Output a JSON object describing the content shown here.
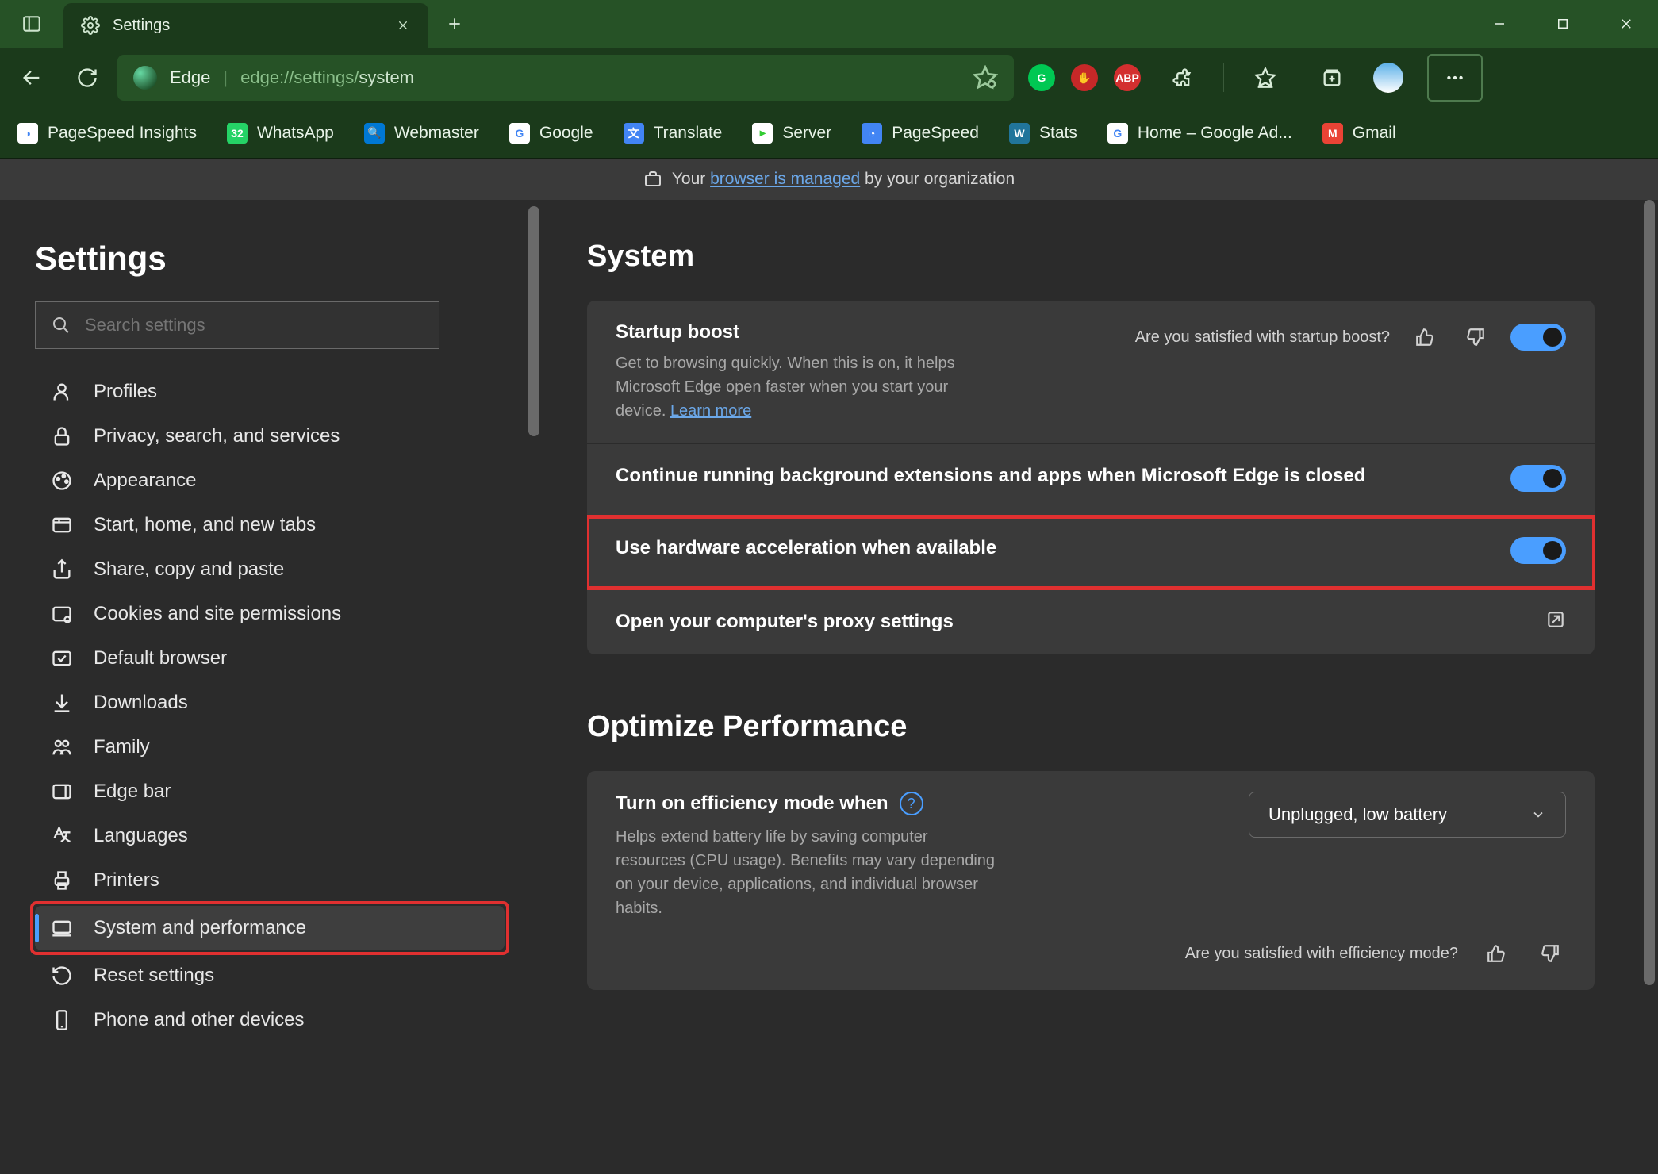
{
  "titlebar": {
    "tab_title": "Settings"
  },
  "toolbar": {
    "app_label": "Edge",
    "url_prefix": "edge://settings/",
    "url_path": "system"
  },
  "bookmarks": [
    {
      "label": "PageSpeed Insights",
      "color": "#fff",
      "bg": "linear-gradient(135deg,#4285f4,#ea4335,#fbbc05,#34a853)"
    },
    {
      "label": "WhatsApp",
      "color": "#fff",
      "bg": "#25d366",
      "badge": "32"
    },
    {
      "label": "Webmaster",
      "color": "#fff",
      "bg": "#0078d4"
    },
    {
      "label": "Google",
      "color": "",
      "bg": ""
    },
    {
      "label": "Translate",
      "color": "#fff",
      "bg": "#4285f4"
    },
    {
      "label": "Server",
      "color": "#3c3",
      "bg": "#fff"
    },
    {
      "label": "PageSpeed",
      "color": "#fff",
      "bg": "#4285f4"
    },
    {
      "label": "Stats",
      "color": "#fff",
      "bg": "#21759b"
    },
    {
      "label": "Home – Google Ad...",
      "color": "",
      "bg": ""
    },
    {
      "label": "Gmail",
      "color": "#fff",
      "bg": "#ea4335"
    }
  ],
  "managed": {
    "prefix": "Your ",
    "link": "browser is managed",
    "suffix": " by your organization"
  },
  "sidebar": {
    "title": "Settings",
    "search_placeholder": "Search settings",
    "items": [
      "Profiles",
      "Privacy, search, and services",
      "Appearance",
      "Start, home, and new tabs",
      "Share, copy and paste",
      "Cookies and site permissions",
      "Default browser",
      "Downloads",
      "Family",
      "Edge bar",
      "Languages",
      "Printers",
      "System and performance",
      "Reset settings",
      "Phone and other devices"
    ],
    "active_index": 12
  },
  "main": {
    "section1_title": "System",
    "startup": {
      "title": "Startup boost",
      "desc_a": "Get to browsing quickly. When this is on, it helps Microsoft Edge open faster when you start your device. ",
      "learn_more": "Learn more",
      "feedback_q": "Are you satisfied with startup boost?"
    },
    "bg_row": {
      "title": "Continue running background extensions and apps when Microsoft Edge is closed"
    },
    "hw_row": {
      "title": "Use hardware acceleration when available"
    },
    "proxy_row": {
      "title": "Open your computer's proxy settings"
    },
    "section2_title": "Optimize Performance",
    "efficiency": {
      "title": "Turn on efficiency mode when",
      "desc": "Helps extend battery life by saving computer resources (CPU usage). Benefits may vary depending on your device, applications, and individual browser habits.",
      "dropdown": "Unplugged, low battery",
      "feedback_q": "Are you satisfied with efficiency mode?"
    }
  }
}
